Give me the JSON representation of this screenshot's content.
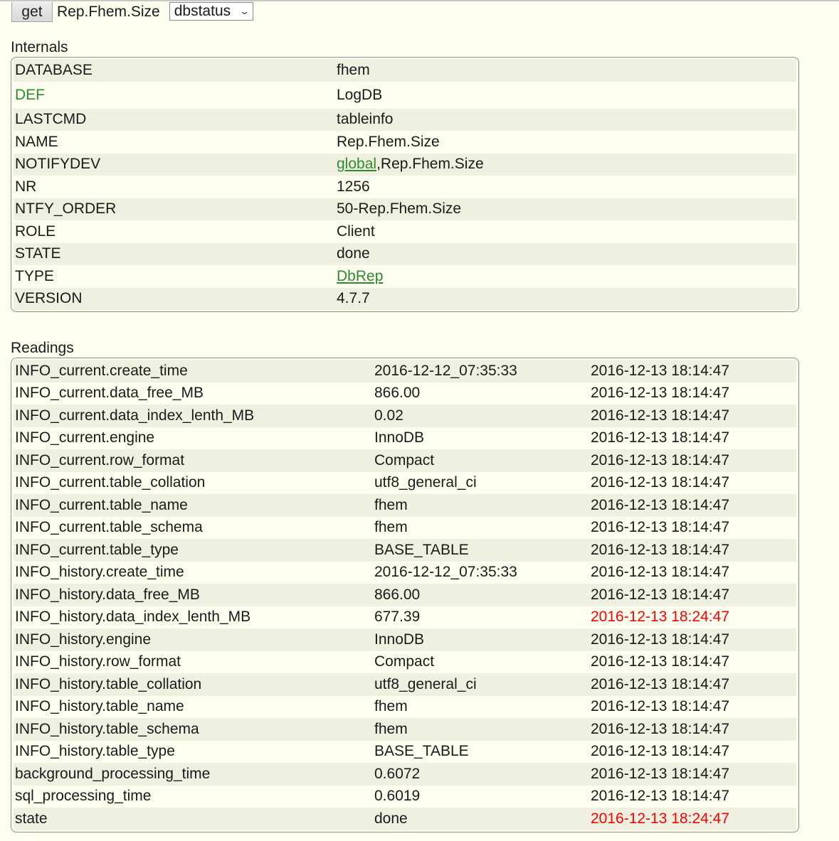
{
  "command_bar": {
    "get_label": "get",
    "device": "Rep.Fhem.Size",
    "select_value": "dbstatus"
  },
  "internals": {
    "title": "Internals",
    "rows": [
      {
        "key": "DATABASE",
        "value": "fhem"
      },
      {
        "key": "DEF",
        "value": "LogDB"
      },
      {
        "key": "LASTCMD",
        "value": "tableinfo"
      },
      {
        "key": "NAME",
        "value": "Rep.Fhem.Size"
      },
      {
        "key": "NOTIFYDEV",
        "link": "global",
        "value": ",Rep.Fhem.Size"
      },
      {
        "key": "NR",
        "value": "1256"
      },
      {
        "key": "NTFY_ORDER",
        "value": "50-Rep.Fhem.Size"
      },
      {
        "key": "ROLE",
        "value": "Client"
      },
      {
        "key": "STATE",
        "value": "done"
      },
      {
        "key": "TYPE",
        "link": "DbRep"
      },
      {
        "key": "VERSION",
        "value": "4.7.7"
      }
    ]
  },
  "readings": {
    "title": "Readings",
    "rows": [
      {
        "name": "INFO_current.create_time",
        "value": "2016-12-12_07:35:33",
        "time": "2016-12-13 18:14:47"
      },
      {
        "name": "INFO_current.data_free_MB",
        "value": "866.00",
        "time": "2016-12-13 18:14:47"
      },
      {
        "name": "INFO_current.data_index_lenth_MB",
        "value": "0.02",
        "time": "2016-12-13 18:14:47"
      },
      {
        "name": "INFO_current.engine",
        "value": "InnoDB",
        "time": "2016-12-13 18:14:47"
      },
      {
        "name": "INFO_current.row_format",
        "value": "Compact",
        "time": "2016-12-13 18:14:47"
      },
      {
        "name": "INFO_current.table_collation",
        "value": "utf8_general_ci",
        "time": "2016-12-13 18:14:47"
      },
      {
        "name": "INFO_current.table_name",
        "value": "fhem",
        "time": "2016-12-13 18:14:47"
      },
      {
        "name": "INFO_current.table_schema",
        "value": "fhem",
        "time": "2016-12-13 18:14:47"
      },
      {
        "name": "INFO_current.table_type",
        "value": "BASE_TABLE",
        "time": "2016-12-13 18:14:47"
      },
      {
        "name": "INFO_history.create_time",
        "value": "2016-12-12_07:35:33",
        "time": "2016-12-13 18:14:47"
      },
      {
        "name": "INFO_history.data_free_MB",
        "value": "866.00",
        "time": "2016-12-13 18:14:47"
      },
      {
        "name": "INFO_history.data_index_lenth_MB",
        "value": "677.39",
        "time": "2016-12-13 18:24:47",
        "changed": true
      },
      {
        "name": "INFO_history.engine",
        "value": "InnoDB",
        "time": "2016-12-13 18:14:47"
      },
      {
        "name": "INFO_history.row_format",
        "value": "Compact",
        "time": "2016-12-13 18:14:47"
      },
      {
        "name": "INFO_history.table_collation",
        "value": "utf8_general_ci",
        "time": "2016-12-13 18:14:47"
      },
      {
        "name": "INFO_history.table_name",
        "value": "fhem",
        "time": "2016-12-13 18:14:47"
      },
      {
        "name": "INFO_history.table_schema",
        "value": "fhem",
        "time": "2016-12-13 18:14:47"
      },
      {
        "name": "INFO_history.table_type",
        "value": "BASE_TABLE",
        "time": "2016-12-13 18:14:47"
      },
      {
        "name": "background_processing_time",
        "value": "0.6072",
        "time": "2016-12-13 18:14:47"
      },
      {
        "name": "sql_processing_time",
        "value": "0.6019",
        "time": "2016-12-13 18:14:47"
      },
      {
        "name": "state",
        "value": "done",
        "time": "2016-12-13 18:24:47",
        "changed": true
      }
    ]
  },
  "colors": {
    "background": "#fffff0",
    "row_odd": "#f0f0e0",
    "link": "#2e8b2e",
    "changed_time": "#ff0000"
  }
}
